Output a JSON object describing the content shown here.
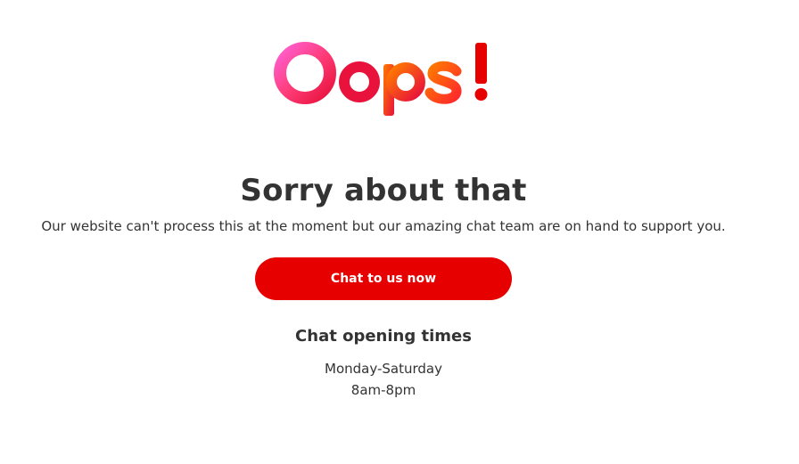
{
  "logo": {
    "text": "Oops!",
    "colors": {
      "pink": "#ff5fd2",
      "red": "#e60000",
      "crimson": "#e8123c",
      "orange": "#ff6a00"
    }
  },
  "error": {
    "title": "Sorry about that",
    "message": "Our website can't process this at the moment but our amazing chat team are on hand to support you."
  },
  "chat_button": {
    "label": "Chat to us now",
    "color": "#e60000"
  },
  "opening_times": {
    "heading": "Chat opening times",
    "days": "Monday-Saturday",
    "hours": "8am-8pm"
  }
}
